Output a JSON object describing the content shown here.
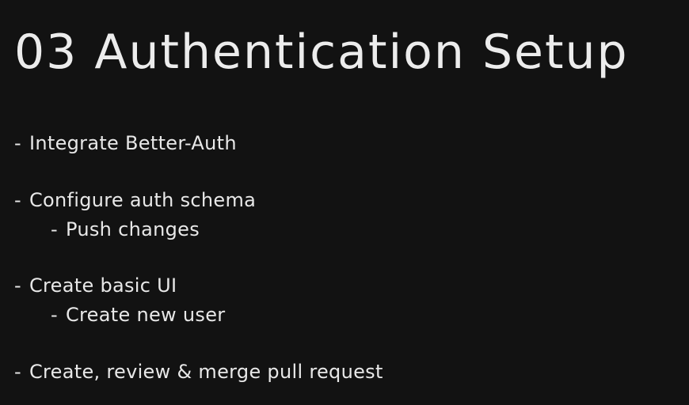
{
  "slide": {
    "title": "03 Authentication Setup",
    "bullet_marker": "-",
    "items": [
      {
        "text": "Integrate Better-Auth"
      },
      {
        "text": "Configure auth schema"
      },
      {
        "text": "Push changes"
      },
      {
        "text": "Create basic UI"
      },
      {
        "text": "Create new user"
      },
      {
        "text": "Create, review & merge pull request"
      }
    ]
  }
}
